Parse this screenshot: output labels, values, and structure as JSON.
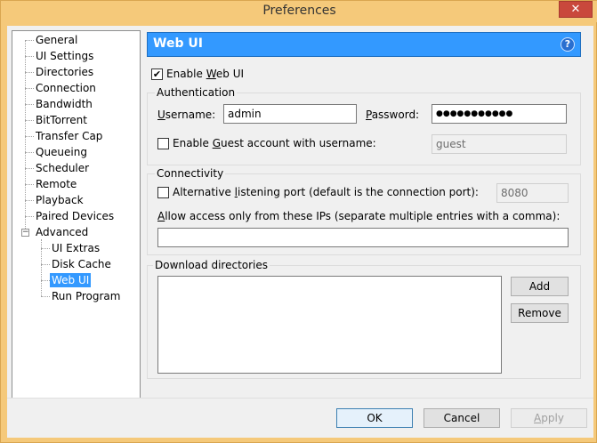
{
  "window": {
    "title": "Preferences",
    "close_glyph": "✕"
  },
  "sidebar": {
    "items": [
      {
        "label": "General"
      },
      {
        "label": "UI Settings"
      },
      {
        "label": "Directories"
      },
      {
        "label": "Connection"
      },
      {
        "label": "Bandwidth"
      },
      {
        "label": "BitTorrent"
      },
      {
        "label": "Transfer Cap"
      },
      {
        "label": "Queueing"
      },
      {
        "label": "Scheduler"
      },
      {
        "label": "Remote"
      },
      {
        "label": "Playback"
      },
      {
        "label": "Paired Devices"
      },
      {
        "label": "Advanced",
        "expanded": true
      },
      {
        "label": "UI Extras"
      },
      {
        "label": "Disk Cache"
      },
      {
        "label": "Web UI",
        "selected": true
      },
      {
        "label": "Run Program"
      }
    ],
    "expander_glyph": "−"
  },
  "header": {
    "title": "Web UI",
    "help_glyph": "?"
  },
  "enable_webui": {
    "label_pre": "Enable ",
    "label_ul": "W",
    "label_post": "eb UI",
    "checked": true,
    "check_glyph": "✔"
  },
  "auth": {
    "title": "Authentication",
    "username_label_ul": "U",
    "username_label_rest": "sername:",
    "username_value": "admin",
    "password_label_ul": "P",
    "password_label_rest": "assword:",
    "password_value": "●●●●●●●●●●●",
    "guest_label_pre": "Enable ",
    "guest_label_ul": "G",
    "guest_label_post": "uest account with username:",
    "guest_checked": false,
    "guest_value": "guest"
  },
  "connectivity": {
    "title": "Connectivity",
    "alt_port_label_pre": "Alternative ",
    "alt_port_label_ul": "l",
    "alt_port_label_post": "istening port (default is the connection port):",
    "alt_port_checked": false,
    "alt_port_value": "8080",
    "allow_ips_label_ul": "A",
    "allow_ips_label_rest": "llow access only from these IPs (separate multiple entries with a comma):",
    "allow_ips_value": ""
  },
  "download_dirs": {
    "title": "Download directories",
    "add_label": "Add",
    "remove_label": "Remove"
  },
  "footer": {
    "ok_label": "OK",
    "cancel_label": "Cancel",
    "apply_label_ul": "A",
    "apply_label_rest": "pply"
  }
}
